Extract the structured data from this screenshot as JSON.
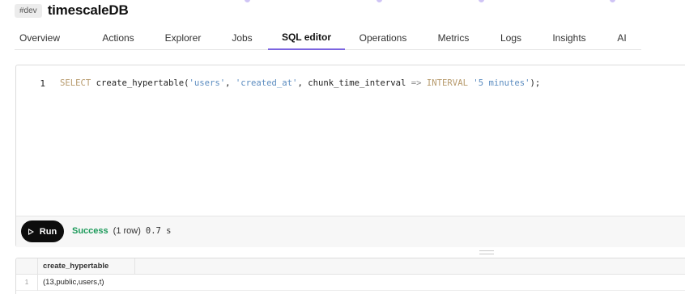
{
  "header": {
    "env_badge": "#dev",
    "service_name": "timescaleDB"
  },
  "tabs": [
    {
      "label": "Overview",
      "active": false
    },
    {
      "label": "Actions",
      "active": false
    },
    {
      "label": "Explorer",
      "active": false
    },
    {
      "label": "Jobs",
      "active": false
    },
    {
      "label": "SQL editor",
      "active": true
    },
    {
      "label": "Operations",
      "active": false
    },
    {
      "label": "Metrics",
      "active": false
    },
    {
      "label": "Logs",
      "active": false
    },
    {
      "label": "Insights",
      "active": false
    },
    {
      "label": "AI",
      "active": false
    }
  ],
  "editor": {
    "line_number": "1",
    "tokens": {
      "select": "SELECT ",
      "fn": "create_hypertable(",
      "arg1": "'users'",
      "sep1": ", ",
      "arg2": "'created_at'",
      "sep2": ", chunk_time_interval ",
      "arrow": "=>",
      "space": " ",
      "interval_kw": "INTERVAL ",
      "arg3": "'5 minutes'",
      "end": ");"
    }
  },
  "toolbar": {
    "run_label": "Run",
    "status": "Success",
    "rows": "(1 row)",
    "duration": "0.7 s"
  },
  "results": {
    "columns": [
      "create_hypertable"
    ],
    "rows": [
      {
        "num": "1",
        "values": [
          "(13,public,users,t)"
        ]
      }
    ]
  },
  "colors": {
    "accent": "#7b64e0",
    "success": "#1c9a5a",
    "keyword": "#b79a6c",
    "string": "#5b8cc0"
  }
}
